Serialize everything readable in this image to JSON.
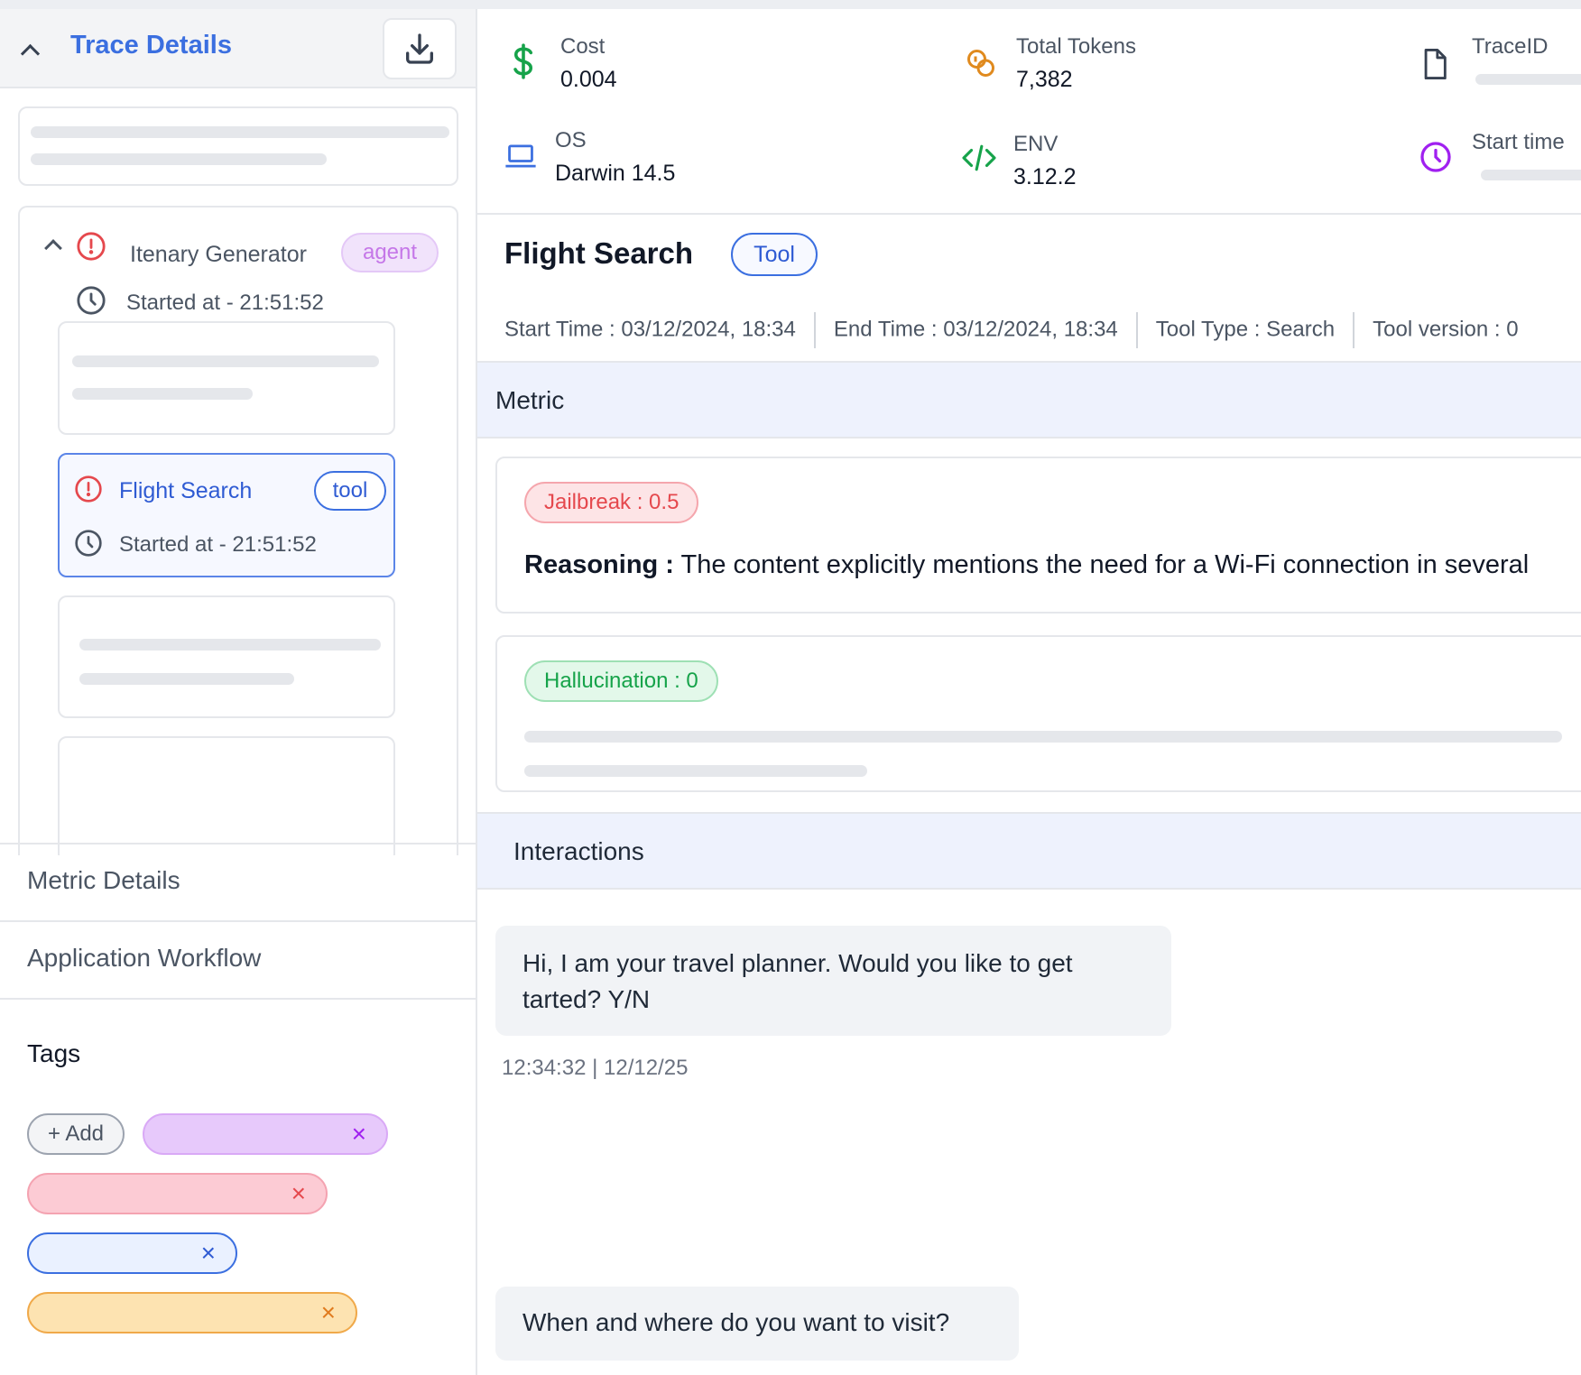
{
  "sidebar": {
    "title": "Trace Details",
    "tree": {
      "agent_node": {
        "title": "Itenary Generator",
        "badge": "agent",
        "started": "Started at - 21:51:52"
      },
      "tool_node": {
        "title": "Flight Search",
        "badge": "tool",
        "started": "Started at - 21:51:52"
      }
    },
    "sections": {
      "metric_details": "Metric Details",
      "application_workflow": "Application Workflow"
    },
    "tags": {
      "title": "Tags",
      "add_label": "+ Add",
      "colors": [
        "#e7c9fb",
        "#fccbd4",
        "#eaf1ff",
        "#fde3b1"
      ],
      "remove_glyph": "×"
    }
  },
  "stats": {
    "cost": {
      "label": "Cost",
      "value": "0.004"
    },
    "total_tokens": {
      "label": "Total Tokens",
      "value": "7,382"
    },
    "trace_id": {
      "label": "TraceID"
    },
    "os": {
      "label": "OS",
      "value": "Darwin 14.5"
    },
    "env": {
      "label": "ENV",
      "value": "3.12.2"
    },
    "start_time": {
      "label": "Start time"
    }
  },
  "detail": {
    "title": "Flight Search",
    "badge": "Tool",
    "start_time": "Start Time : 03/12/2024, 18:34",
    "end_time": "End Time : 03/12/2024, 18:34",
    "tool_type": "Tool Type : Search",
    "tool_version": "Tool version : 0"
  },
  "metric": {
    "header": "Metric",
    "jailbreak": {
      "label": "Jailbreak : 0.5",
      "reasoning_label": "Reasoning :",
      "reasoning_text": " The content explicitly mentions the need for a Wi-Fi connection in several"
    },
    "hallucination": {
      "label": "Hallucination : 0"
    }
  },
  "interactions": {
    "header": "Interactions",
    "messages": [
      {
        "text": "Hi, I am your travel planner. Would you like to get tarted? Y/N",
        "timestamp": "12:34:32 | 12/12/25"
      },
      {
        "text": "When and where do you want to visit?"
      }
    ]
  },
  "colors": {
    "accent": "#3b6fe0",
    "error": "#e5484d",
    "cost": "#16a34a",
    "tokens": "#e08a1e",
    "env": "#16a34a",
    "start_time": "#a020f0"
  }
}
